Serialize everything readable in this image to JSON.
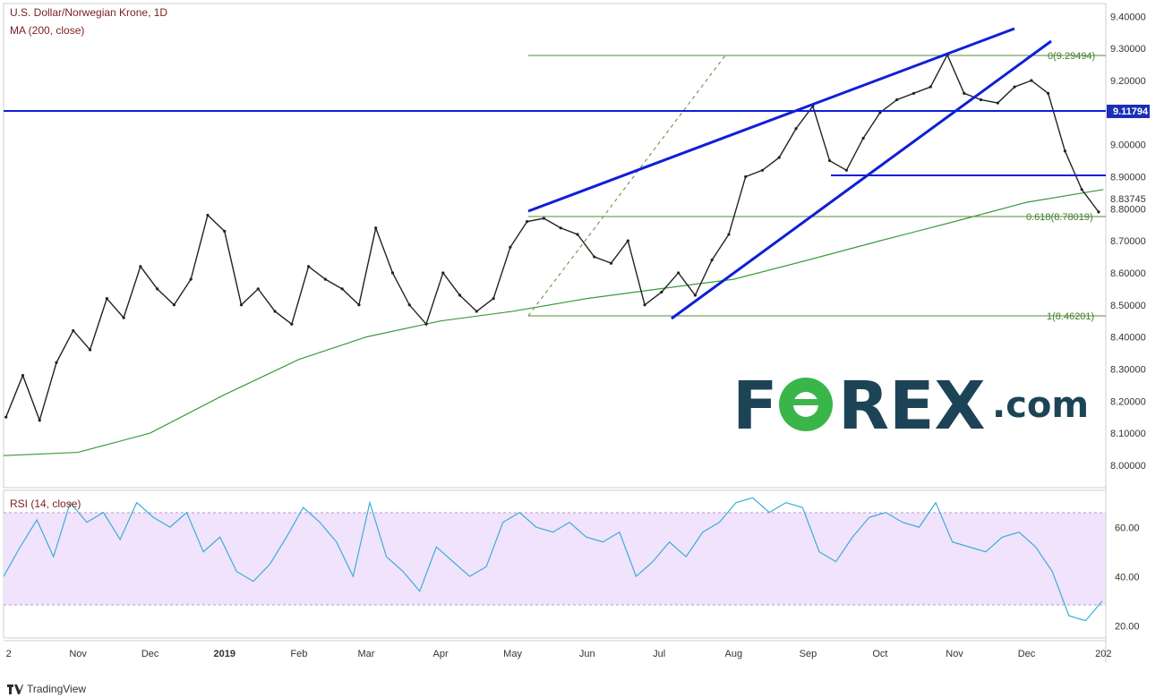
{
  "header": {
    "title": "U.S. Dollar/Norwegian Krone, 1D",
    "ma_label": "MA (200, close)",
    "rsi_label": "RSI (14, close)"
  },
  "footer": {
    "brand": "TradingView"
  },
  "watermark": {
    "left": "F",
    "o_glyph": "O",
    "right": "REX",
    "suffix": ".com"
  },
  "colors": {
    "blue_line": "#0f1fd6",
    "ma_line": "#3c9a3c",
    "fib_line": "#5a8a3a",
    "rsi_line": "#3aaed8",
    "rsi_band": "#f1e3fb",
    "badge": "#1b2fb8",
    "forex_dark": "#1d4456",
    "forex_green": "#3ab54a"
  },
  "chart_data": [
    {
      "type": "line",
      "title": "U.S. Dollar/Norwegian Krone, 1D",
      "y_ticks": [
        8.0,
        8.1,
        8.2,
        8.3,
        8.4,
        8.5,
        8.6,
        8.7,
        8.8,
        8.9,
        9.0,
        9.1,
        9.2,
        9.3,
        9.4
      ],
      "y_tick_labels": [
        "8.00000",
        "8.10000",
        "8.20000",
        "8.30000",
        "8.40000",
        "8.50000",
        "8.60000",
        "8.70000",
        "8.80000",
        "8.90000",
        "9.00000",
        "9.10000",
        "9.20000",
        "9.30000",
        "9.40000"
      ],
      "ylim": [
        7.93,
        9.44
      ],
      "x_tick_labels": [
        "2",
        "Nov",
        "Dec",
        "2019",
        "Feb",
        "Mar",
        "Apr",
        "May",
        "Jun",
        "Jul",
        "Aug",
        "Sep",
        "Oct",
        "Nov",
        "Dec",
        "202"
      ],
      "series": [
        {
          "name": "U.S. Dollar/Norwegian Krone, 1D",
          "x": [
            "2018-10-02",
            "2018-10-09",
            "2018-10-16",
            "2018-10-23",
            "2018-10-30",
            "2018-11-06",
            "2018-11-13",
            "2018-11-20",
            "2018-11-27",
            "2018-12-04",
            "2018-12-11",
            "2018-12-18",
            "2018-12-25",
            "2019-01-01",
            "2019-01-08",
            "2019-01-15",
            "2019-01-22",
            "2019-01-29",
            "2019-02-05",
            "2019-02-12",
            "2019-02-19",
            "2019-02-26",
            "2019-03-05",
            "2019-03-12",
            "2019-03-19",
            "2019-03-26",
            "2019-04-02",
            "2019-04-09",
            "2019-04-16",
            "2019-04-23",
            "2019-04-30",
            "2019-05-07",
            "2019-05-14",
            "2019-05-21",
            "2019-05-28",
            "2019-06-04",
            "2019-06-11",
            "2019-06-18",
            "2019-06-25",
            "2019-07-02",
            "2019-07-09",
            "2019-07-16",
            "2019-07-23",
            "2019-07-30",
            "2019-08-06",
            "2019-08-13",
            "2019-08-20",
            "2019-08-27",
            "2019-09-03",
            "2019-09-10",
            "2019-09-17",
            "2019-09-24",
            "2019-10-01",
            "2019-10-08",
            "2019-10-15",
            "2019-10-22",
            "2019-10-29",
            "2019-11-05",
            "2019-11-12",
            "2019-11-19",
            "2019-11-26",
            "2019-12-03",
            "2019-12-10",
            "2019-12-17",
            "2019-12-24",
            "2019-12-31"
          ],
          "values": [
            8.15,
            8.28,
            8.14,
            8.32,
            8.42,
            8.36,
            8.52,
            8.46,
            8.62,
            8.55,
            8.5,
            8.58,
            8.78,
            8.73,
            8.5,
            8.55,
            8.48,
            8.44,
            8.62,
            8.58,
            8.55,
            8.5,
            8.74,
            8.6,
            8.5,
            8.44,
            8.6,
            8.53,
            8.48,
            8.52,
            8.68,
            8.76,
            8.77,
            8.74,
            8.72,
            8.65,
            8.63,
            8.7,
            8.5,
            8.54,
            8.6,
            8.53,
            8.64,
            8.72,
            8.9,
            8.92,
            8.96,
            9.05,
            9.12,
            8.95,
            8.92,
            9.02,
            9.1,
            9.14,
            9.16,
            9.18,
            9.28,
            9.16,
            9.14,
            9.13,
            9.18,
            9.2,
            9.16,
            8.98,
            8.86,
            8.79
          ]
        },
        {
          "name": "MA (200, close)",
          "x": [
            "2018-10-01",
            "2018-11-01",
            "2018-12-01",
            "2019-01-01",
            "2019-02-01",
            "2019-03-01",
            "2019-04-01",
            "2019-05-01",
            "2019-06-01",
            "2019-07-01",
            "2019-08-01",
            "2019-09-01",
            "2019-10-01",
            "2019-11-01",
            "2019-12-01",
            "2020-01-02"
          ],
          "values": [
            8.03,
            8.04,
            8.1,
            8.22,
            8.33,
            8.4,
            8.45,
            8.48,
            8.52,
            8.55,
            8.58,
            8.64,
            8.7,
            8.76,
            8.82,
            8.86
          ]
        }
      ],
      "annotations": {
        "horizontal_price": 9.11794,
        "horizontal_price_label": "9.11794",
        "current_price_label": "8.83745",
        "support_line": 8.91,
        "fib_levels": [
          {
            "label": "0(9.29494)",
            "value": 9.29494
          },
          {
            "label": "0.618(8.78019)",
            "value": 8.78019
          },
          {
            "label": "1(8.46201)",
            "value": 8.46201
          }
        ]
      }
    },
    {
      "type": "line",
      "title": "RSI (14, close)",
      "y_ticks": [
        20,
        40,
        60
      ],
      "y_tick_labels": [
        "20.00",
        "40.00",
        "60.00"
      ],
      "ylim": [
        15,
        75
      ],
      "band": [
        30,
        70
      ],
      "series": [
        {
          "name": "RSI (14, close)",
          "values": [
            40,
            52,
            63,
            48,
            70,
            62,
            66,
            55,
            70,
            64,
            60,
            66,
            50,
            56,
            42,
            38,
            45,
            56,
            68,
            62,
            54,
            40,
            70,
            48,
            42,
            34,
            52,
            46,
            40,
            44,
            62,
            66,
            60,
            58,
            62,
            56,
            54,
            58,
            40,
            46,
            54,
            48,
            58,
            62,
            70,
            72,
            66,
            70,
            68,
            50,
            46,
            56,
            64,
            66,
            62,
            60,
            70,
            54,
            52,
            50,
            56,
            58,
            52,
            42,
            24,
            22,
            30
          ]
        }
      ]
    }
  ]
}
